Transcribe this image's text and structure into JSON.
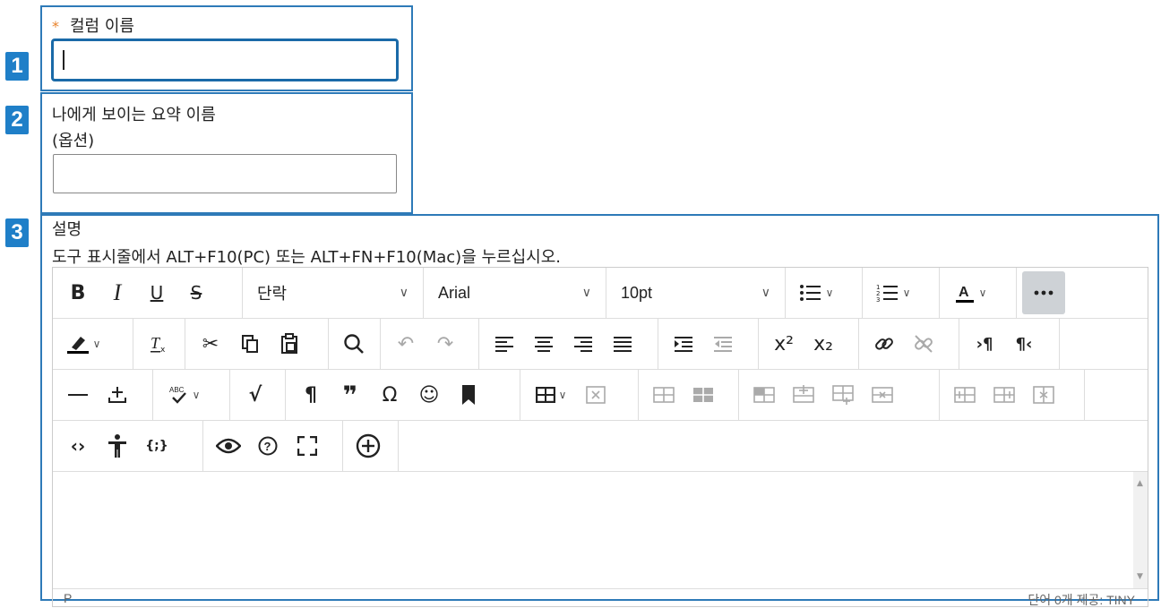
{
  "badges": [
    "1",
    "2",
    "3"
  ],
  "column_name": {
    "required_marker": "*",
    "label": "컬럼 이름",
    "value": ""
  },
  "summary_name": {
    "label": "나에게 보이는 요약 이름",
    "optional": "(옵션)",
    "value": ""
  },
  "description": {
    "label": "설명",
    "hint": "도구 표시줄에서 ALT+F10(PC) 또는 ALT+FN+F10(Mac)을 누르십시오."
  },
  "toolbar": {
    "block_format": "단락",
    "font_family": "Arial",
    "font_size": "10pt",
    "bold": "B",
    "italic": "I",
    "underline": "U",
    "strikethrough": "S",
    "superscript": "x²",
    "subscript": "x₂",
    "pilcrow": "¶",
    "omega": "Ω"
  },
  "statusbar": {
    "path": "P",
    "right": "단어 0개 제공: TINY"
  },
  "colors": {
    "accent": "#2e7ab8",
    "badge": "#1f7fc8",
    "required": "#e8822b"
  }
}
